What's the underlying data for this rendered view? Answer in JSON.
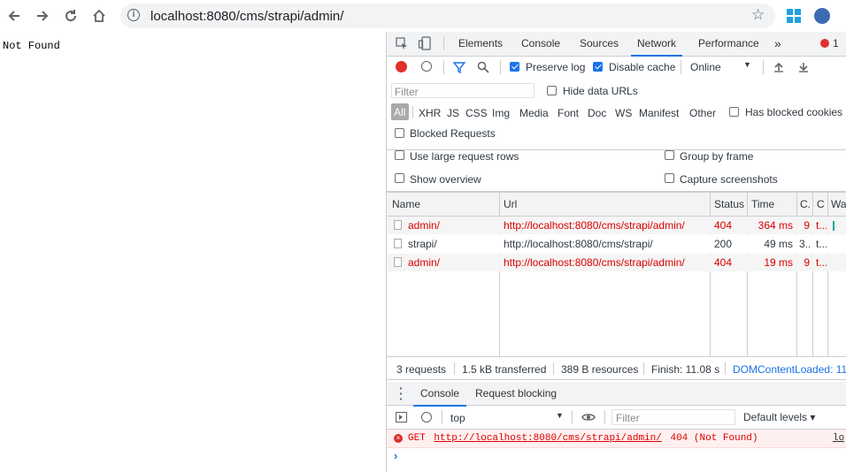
{
  "browser": {
    "url": "localhost:8080/cms/strapi/admin/"
  },
  "page": {
    "body_text": "Not Found"
  },
  "devtools": {
    "tabs": [
      "Elements",
      "Console",
      "Sources",
      "Network",
      "Performance"
    ],
    "active_tab": "Network",
    "error_count": "1",
    "toolbar": {
      "preserve_log": "Preserve log",
      "disable_cache": "Disable cache",
      "throttle": "Online"
    },
    "filter": {
      "placeholder": "Filter",
      "hide_data_urls": "Hide data URLs",
      "types": [
        "All",
        "XHR",
        "JS",
        "CSS",
        "Img",
        "Media",
        "Font",
        "Doc",
        "WS",
        "Manifest",
        "Other"
      ],
      "has_blocked_cookies": "Has blocked cookies",
      "blocked_requests": "Blocked Requests"
    },
    "settings": {
      "large_rows": "Use large request rows",
      "group_by_frame": "Group by frame",
      "show_overview": "Show overview",
      "capture_screenshots": "Capture screenshots"
    },
    "table": {
      "columns": [
        "Name",
        "Url",
        "Status",
        "Time",
        "C.",
        "C",
        "Wa"
      ],
      "rows": [
        {
          "name": "admin/",
          "url": "http://localhost:8080/cms/strapi/admin/",
          "status": "404",
          "time": "364 ms",
          "c1": "9",
          "c2": "t...",
          "error": true
        },
        {
          "name": "strapi/",
          "url": "http://localhost:8080/cms/strapi/",
          "status": "200",
          "time": "49 ms",
          "c1": "3...",
          "c2": "t...",
          "error": false
        },
        {
          "name": "admin/",
          "url": "http://localhost:8080/cms/strapi/admin/",
          "status": "404",
          "time": "19 ms",
          "c1": "9",
          "c2": "t...",
          "error": true
        }
      ]
    },
    "summary": {
      "requests": "3 requests",
      "transferred": "1.5 kB transferred",
      "resources": "389 B resources",
      "finish": "Finish: 11.08 s",
      "dcl": "DOMContentLoaded: 11"
    },
    "drawer": {
      "tabs": [
        "Console",
        "Request blocking"
      ],
      "context": "top",
      "filter_placeholder": "Filter",
      "levels": "Default levels ▾",
      "error": {
        "method": "GET",
        "url": "http://localhost:8080/cms/strapi/admin/",
        "status": "404 (Not Found)",
        "source": "lo"
      },
      "prompt": "›"
    }
  }
}
